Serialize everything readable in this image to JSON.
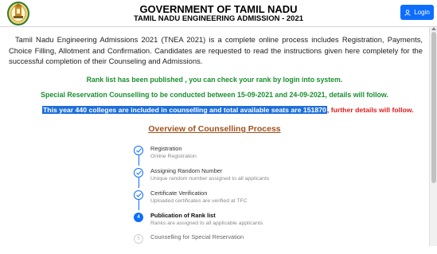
{
  "header": {
    "title": "GOVERNMENT OF TAMIL NADU",
    "subtitle": "TAMIL NADU ENGINEERING ADMISSION - 2021",
    "login_label": "Login",
    "logo_icon": "tamil-nadu-emblem-icon"
  },
  "intro": "Tamil Nadu Engineering Admissions 2021 (TNEA 2021) is a complete online process includes Registration, Payments, Choice Filling, Allotment and Confirmation. Candidates are requested to read the instructions given here completely for the successful completion of their Counseling and Admissions.",
  "notices": {
    "rank_list": "Rank list has been published , you can check your rank by login into system.",
    "special_reservation": "Special Reservation Counselling to be conducted between 15-09-2021 and 24-09-2021, details will follow.",
    "seats_highlight": "This year 440 colleges are included in counselling and total available seats are 151870",
    "seats_followup": ", further details will follow."
  },
  "overview_title": "Overview of Counselling Process",
  "steps": [
    {
      "title": "Registration",
      "subtitle": "Online Registration",
      "status": "done",
      "number": ""
    },
    {
      "title": "Assigning Random Number",
      "subtitle": "Unique random number assigned to all applicants",
      "status": "done",
      "number": ""
    },
    {
      "title": "Certificate Verification",
      "subtitle": "Uploaded certificates are verified at TFC",
      "status": "done",
      "number": ""
    },
    {
      "title": "Publication of Rank list",
      "subtitle": "Ranks are assigned to all applicable applicants",
      "status": "active",
      "number": "4"
    },
    {
      "title": "Counselling for Special Reservation",
      "subtitle": "",
      "status": "pending",
      "number": "5"
    }
  ],
  "colors": {
    "accent": "#0d6efd",
    "notice_green": "#1a8f2f",
    "overview_brown": "#a0501a",
    "alert_red": "#e01a1a",
    "highlight_blue": "#1e6fd9"
  }
}
